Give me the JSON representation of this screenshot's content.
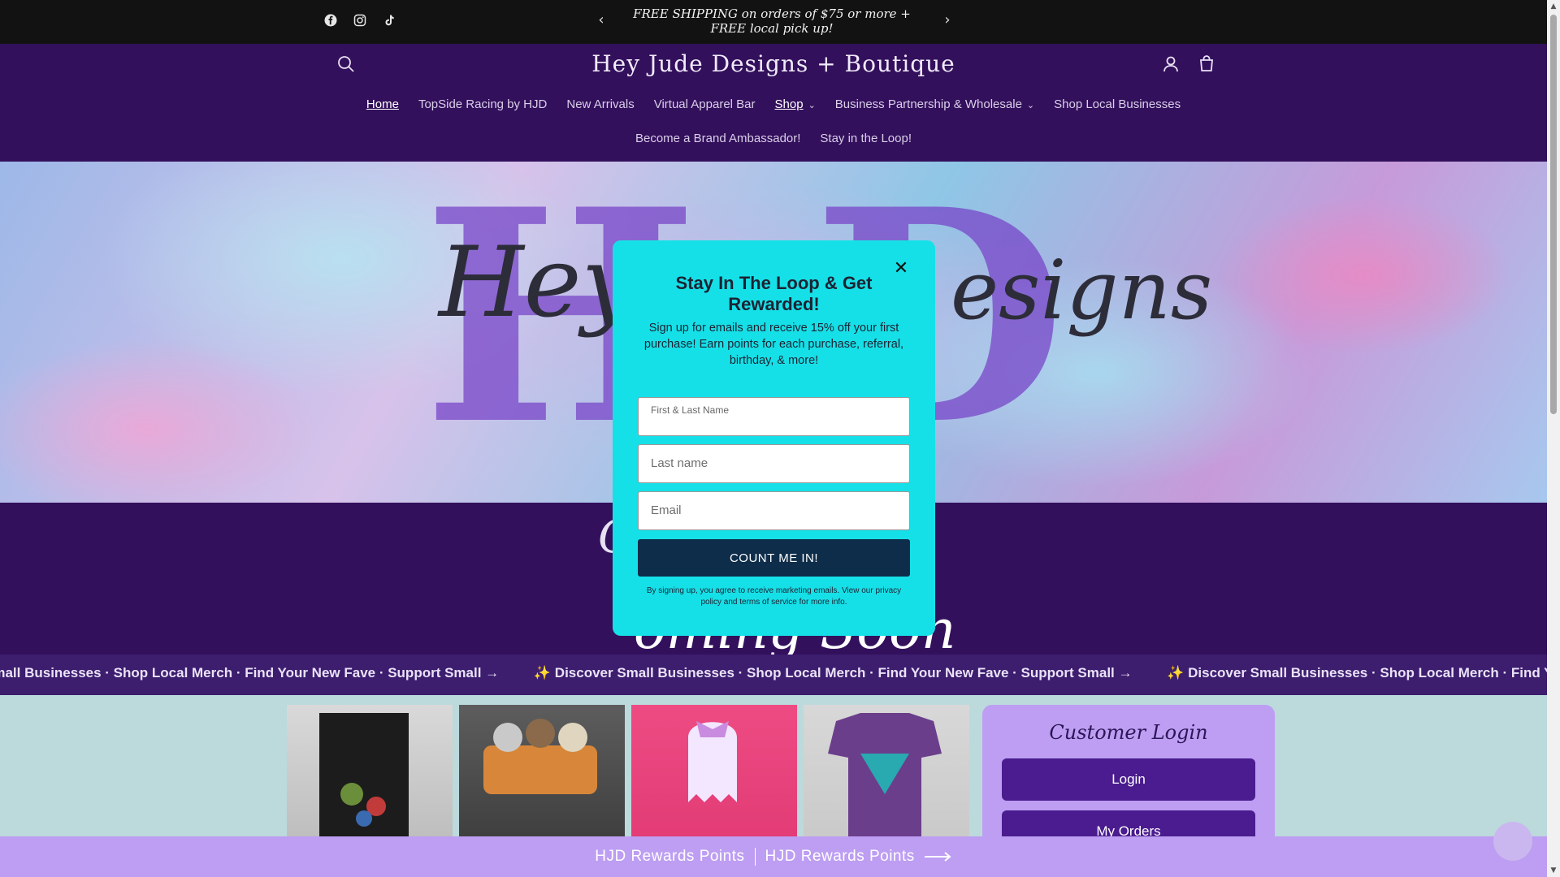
{
  "announcement": {
    "text": "FREE SHIPPING on orders of $75 or more + FREE local pick up!",
    "prev_icon": "chevron-left-icon",
    "next_icon": "chevron-right-icon"
  },
  "social": [
    {
      "name": "facebook-icon"
    },
    {
      "name": "instagram-icon"
    },
    {
      "name": "tiktok-icon"
    }
  ],
  "header": {
    "brand": "Hey Jude Designs + Boutique",
    "search_icon": "search-icon",
    "account_icon": "account-icon",
    "cart_icon": "cart-icon"
  },
  "nav": {
    "row1": [
      "Home",
      "TopSide Racing by HJD",
      "New Arrivals",
      "Virtual Apparel Bar",
      "Shop",
      "Business Partnership & Wholesale",
      "Shop Local Businesses"
    ],
    "row2": [
      "Become a Brand Ambassador!",
      "Stay in the Loop!"
    ]
  },
  "marquee": {
    "items": [
      "Small Businesses · Shop Local Merch · Find Your New Fave · Support Small →",
      "✨ Discover Small Businesses · Shop Local Merch · Find Your New Fave · Support Small →",
      "✨ Discover Small Businesses · Shop Local Merch · Find Your New Fave · Support Small →"
    ]
  },
  "login_card": {
    "title": "Customer Login",
    "login_label": "Login",
    "orders_label": "My Orders"
  },
  "rewards": {
    "left": "HJD Rewards Points",
    "right": "HJD Rewards Points"
  },
  "popup": {
    "title": "Stay In The Loop & Get Rewarded!",
    "description": "Sign up for emails and receive 15% off your first purchase! Earn points for each purchase, referral, birthday, & more!",
    "field1_label": "First & Last Name",
    "field2_placeholder": "Last name",
    "field3_placeholder": "Email",
    "cta": "COUNT ME IN!",
    "legal": "By signing up, you agree to receive marketing emails. View our privacy policy and terms of service for more info."
  },
  "colors": {
    "announcement_bg": "#121212",
    "header_bg": "#33105c",
    "popup_bg": "#16e0e7",
    "cta_bg": "#0e2d4a",
    "login_card_bg": "#bd9ef2",
    "marquee_bg": "#3c1d6e"
  }
}
